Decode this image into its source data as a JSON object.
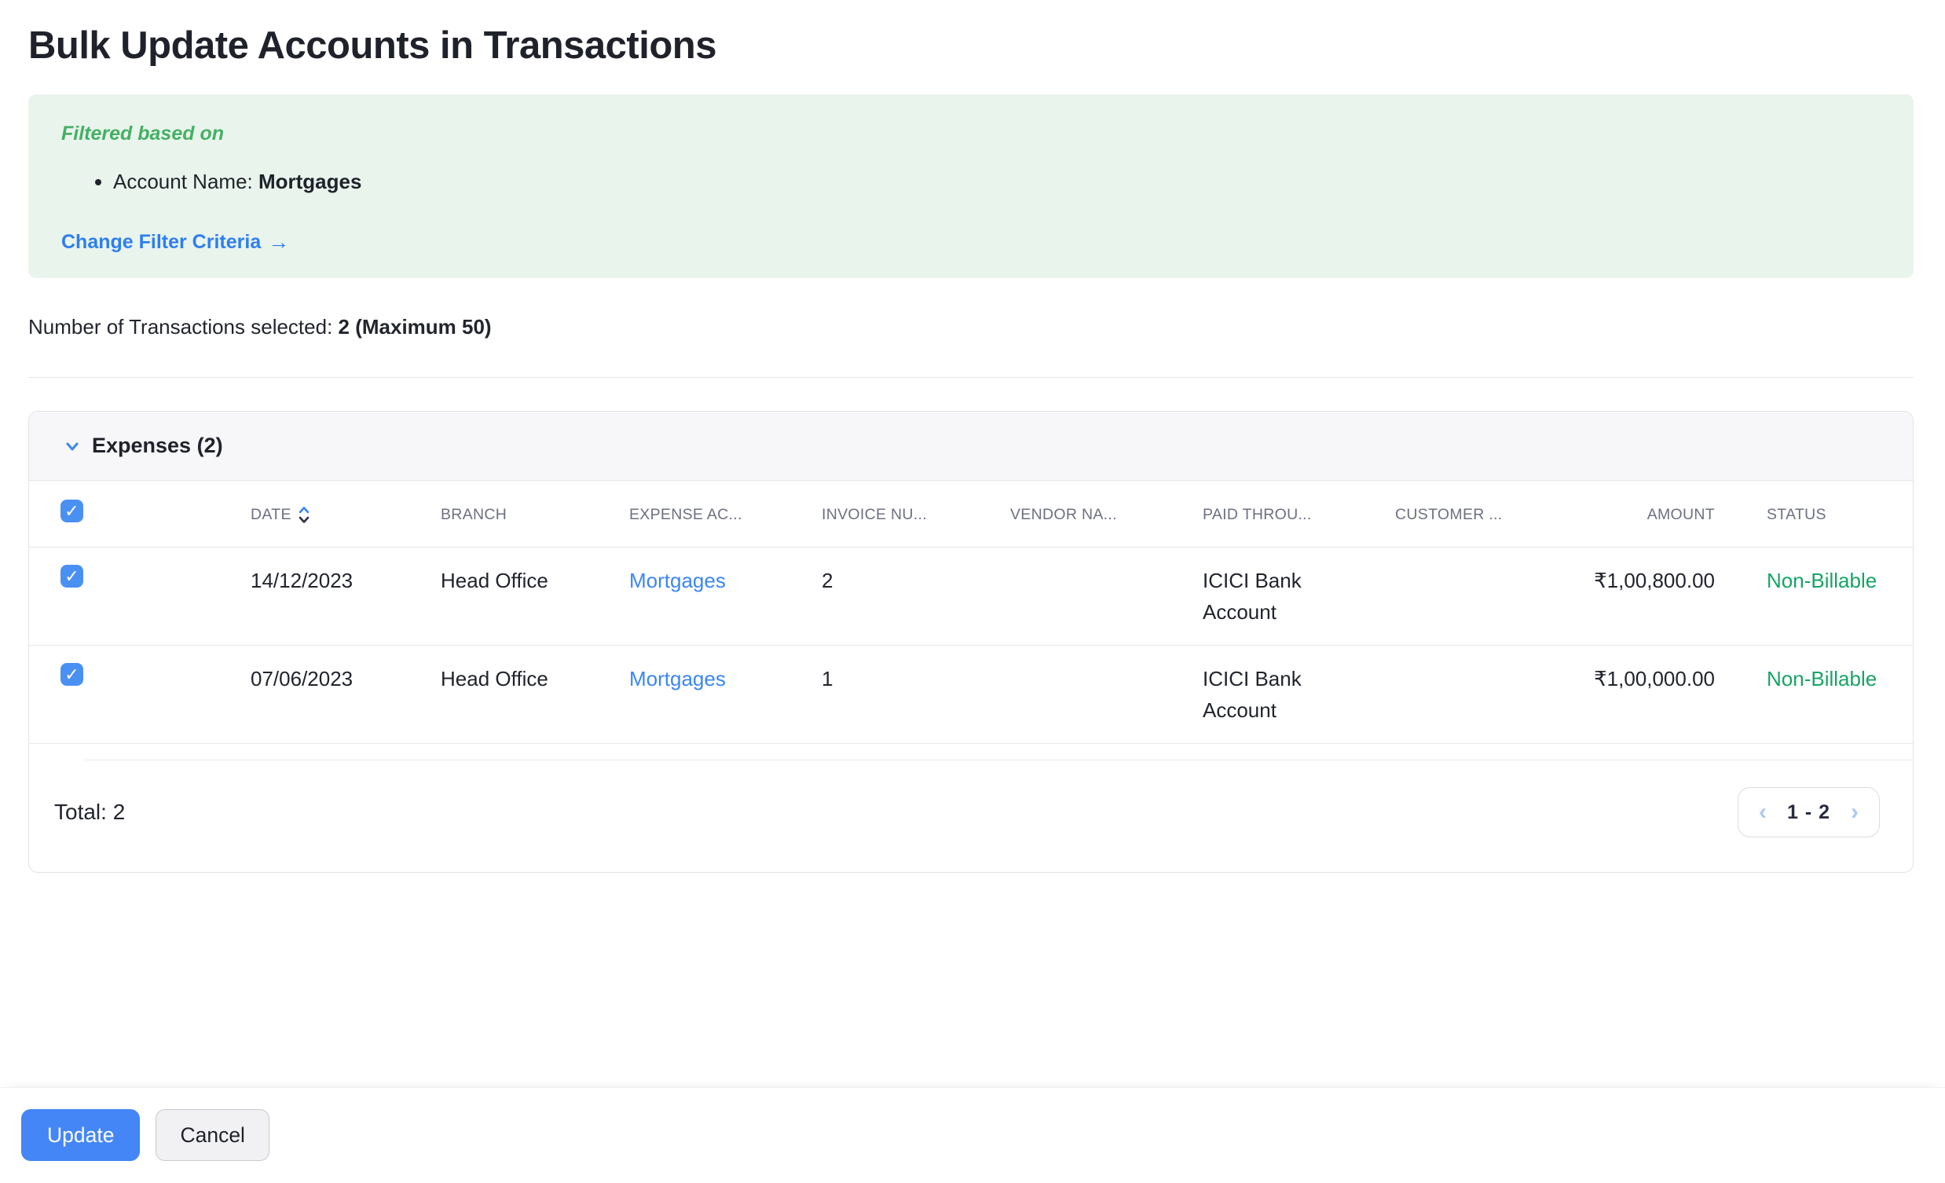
{
  "page": {
    "title": "Bulk Update Accounts in Transactions"
  },
  "filter_box": {
    "heading": "Filtered based on",
    "item_label": "Account Name: ",
    "item_value": "Mortgages",
    "change_link_label": "Change Filter Criteria",
    "arrow_icon": "→"
  },
  "selection": {
    "label": "Number of Transactions selected: ",
    "value": "2 (Maximum 50)"
  },
  "expenses": {
    "title": "Expenses (2)",
    "select_all_checked": true,
    "columns": [
      "DATE",
      "BRANCH",
      "EXPENSE AC...",
      "INVOICE NU...",
      "VENDOR NA...",
      "PAID THROU...",
      "CUSTOMER ...",
      "AMOUNT",
      "STATUS"
    ],
    "rows": [
      {
        "checked": true,
        "date": "14/12/2023",
        "branch": "Head Office",
        "expense_account": "Mortgages",
        "invoice_number": "2",
        "vendor_name": "",
        "paid_through": "ICICI Bank Account",
        "customer_name": "",
        "amount": "₹1,00,800.00",
        "status": "Non-Billable"
      },
      {
        "checked": true,
        "date": "07/06/2023",
        "branch": "Head Office",
        "expense_account": "Mortgages",
        "invoice_number": "1",
        "vendor_name": "",
        "paid_through": "ICICI Bank Account",
        "customer_name": "",
        "amount": "₹1,00,000.00",
        "status": "Non-Billable"
      }
    ],
    "total_label": "Total: 2",
    "pagination": {
      "prev_icon": "‹",
      "range": "1 - 2",
      "next_icon": "›"
    }
  },
  "actions": {
    "update_label": "Update",
    "cancel_label": "Cancel"
  },
  "colors": {
    "accent_blue": "#4486f6",
    "link_blue": "#2e7ef0",
    "filter_green": "#45b065",
    "filter_bg_green": "#e9f4ec",
    "status_green": "#17a464",
    "checkbox_blue": "#4a90f3"
  }
}
